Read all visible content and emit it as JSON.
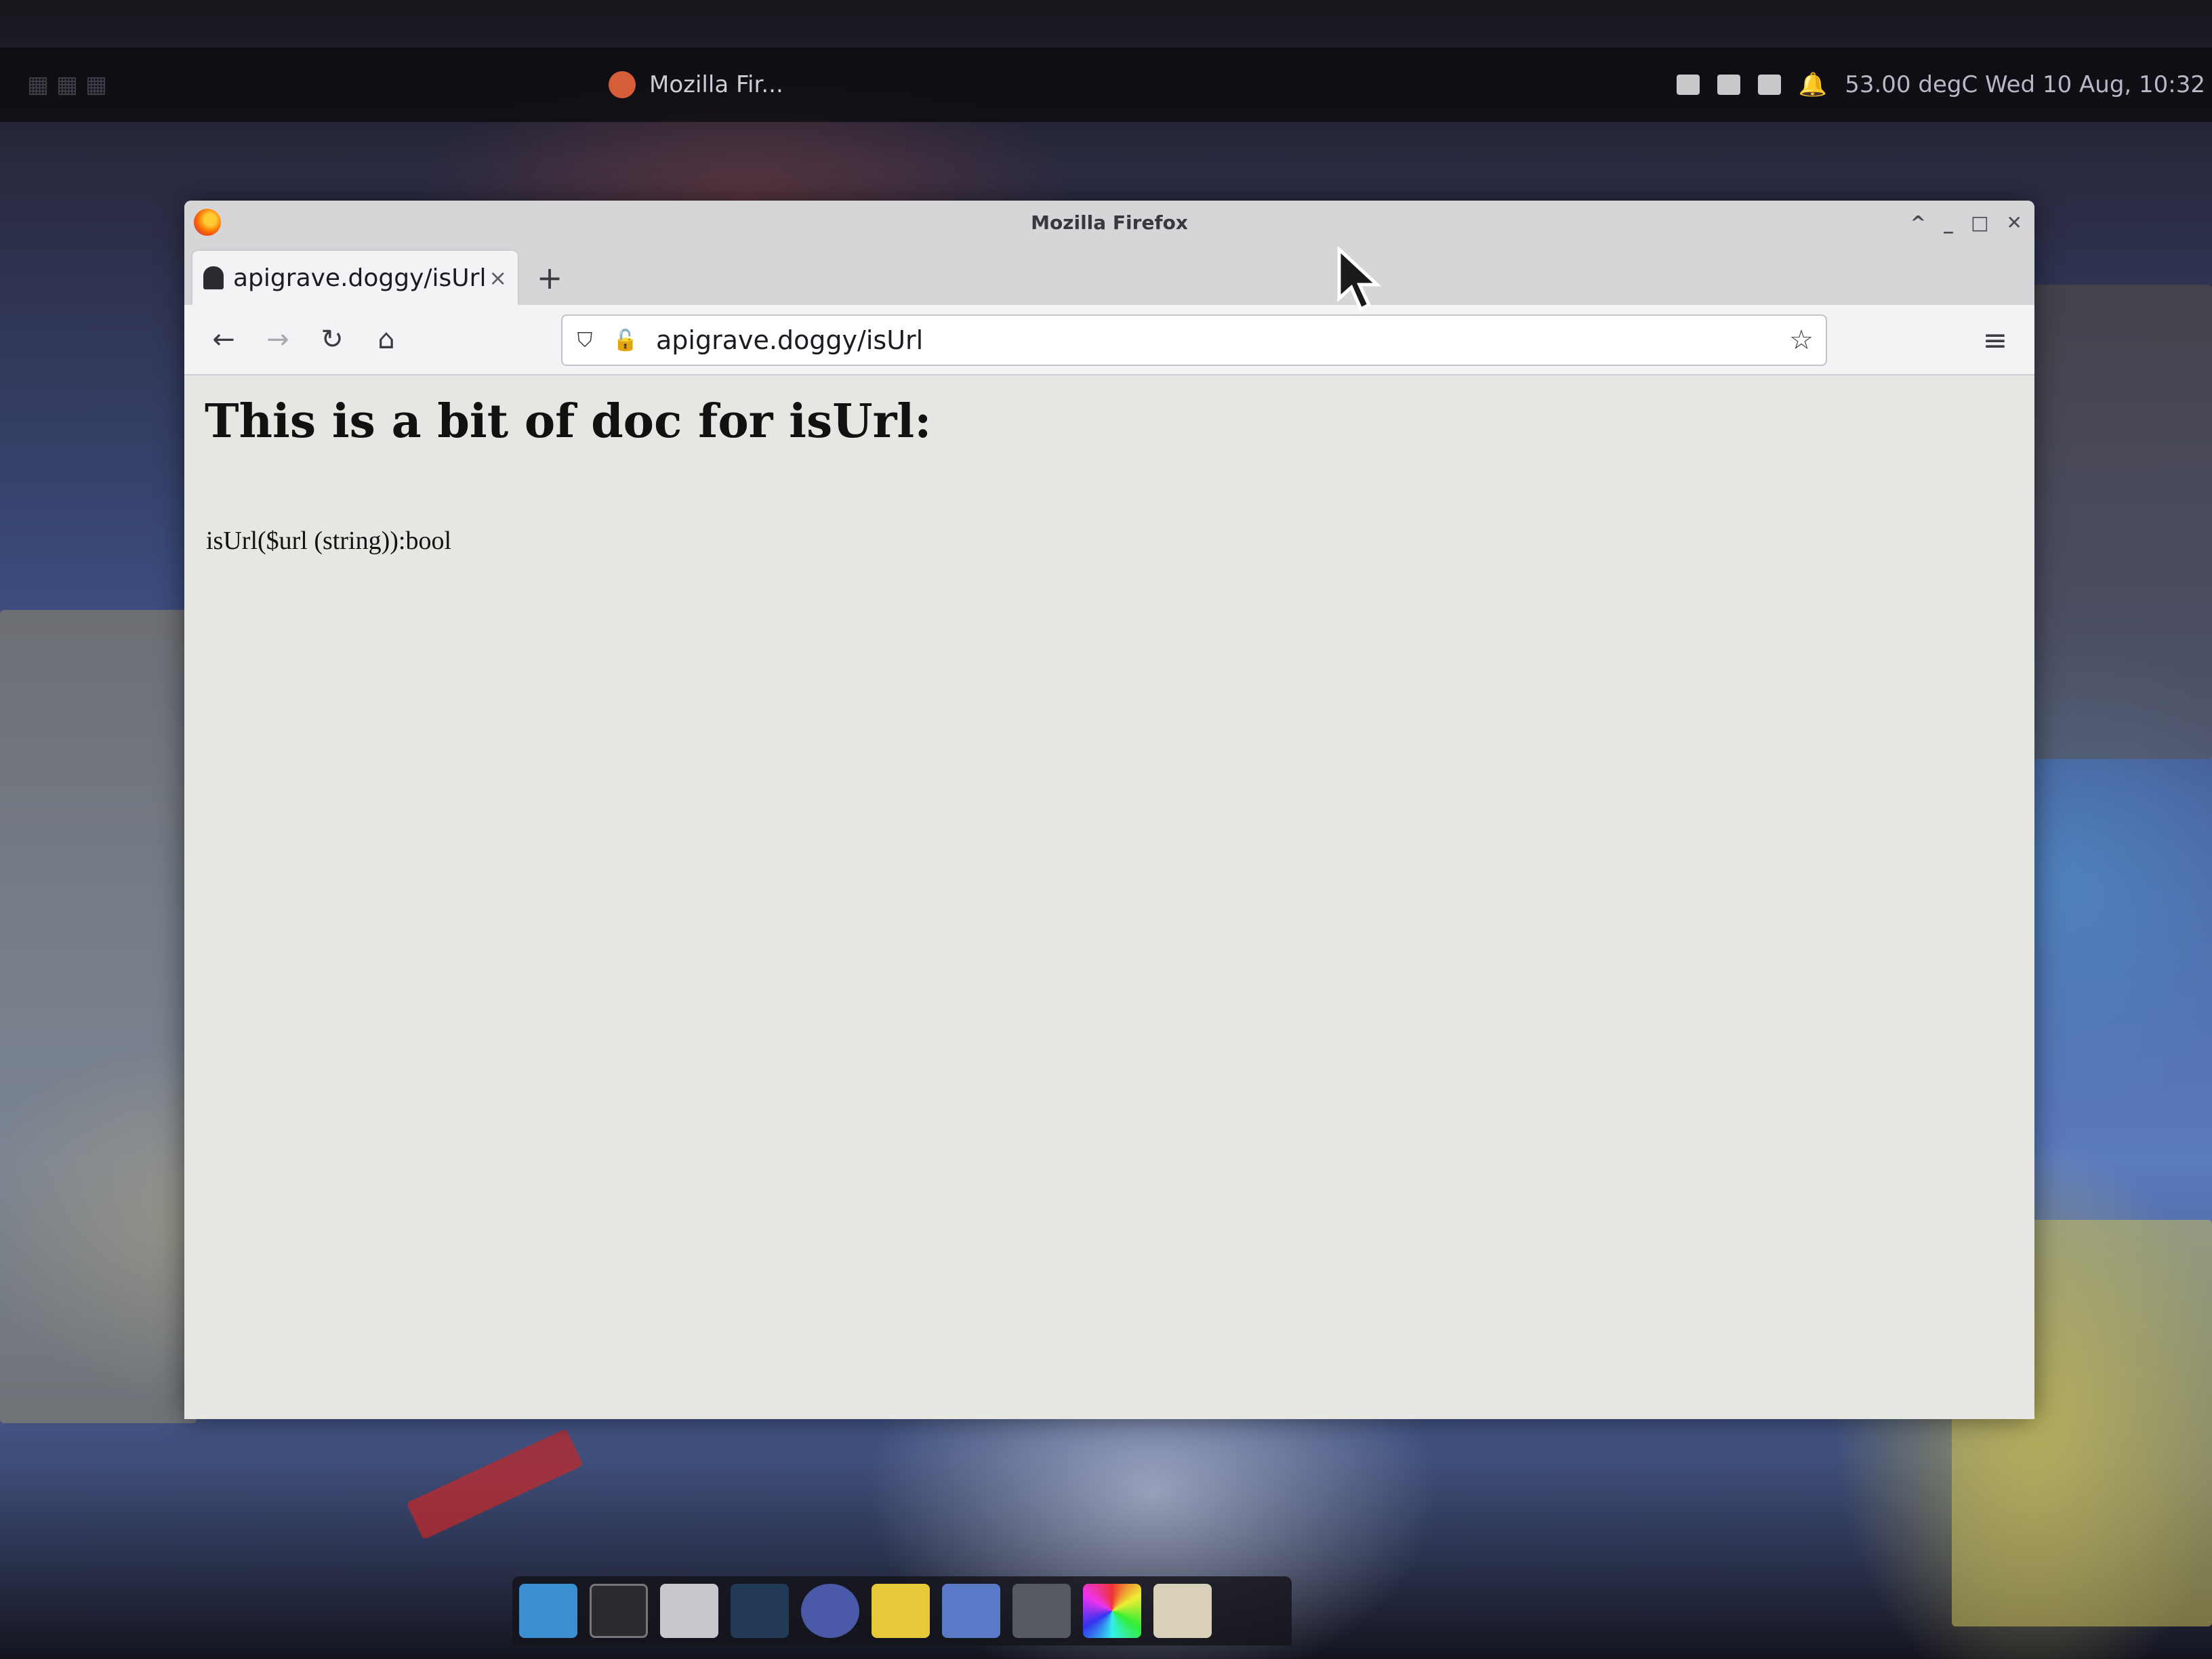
{
  "colors": {
    "accent": "#0060df",
    "window_bg": "#f3f3f5",
    "content_bg": "#e6e6e3"
  },
  "top_panel": {
    "active_task": "Mozilla Fir...",
    "clock": "53.00 degC  Wed 10 Aug, 10:32"
  },
  "window": {
    "title": "Mozilla Firefox",
    "controls": [
      "^",
      "_",
      "□",
      "✕"
    ]
  },
  "tabs": [
    {
      "label": "apigrave.doggy/isUrl",
      "close": "×",
      "favicon": "tombstone-icon"
    }
  ],
  "new_tab_label": "+",
  "nav": {
    "back": "←",
    "forward": "→",
    "reload": "↻",
    "home": "⌂",
    "menu": "≡"
  },
  "urlbar": {
    "value": "apigrave.doggy/isUrl",
    "bookmark": "☆"
  },
  "page": {
    "heading": "This is a bit of doc for isUrl:",
    "signature": "isUrl($url (string)):bool"
  },
  "dock_items": [
    "files-icon",
    "terminal-icon",
    "image-viewer-icon",
    "media-icon",
    "search-icon",
    "editor-icon",
    "calculator-icon",
    "settings-icon",
    "color-icon",
    "folder-icon"
  ]
}
